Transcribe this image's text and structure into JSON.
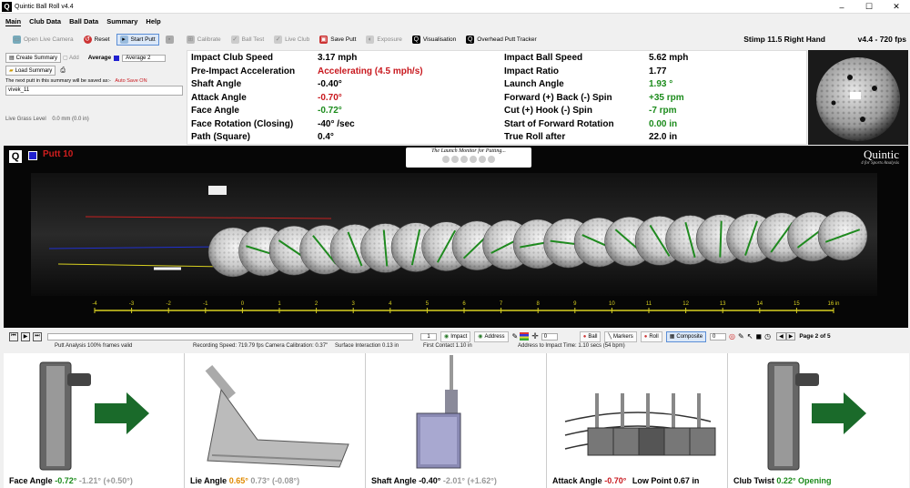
{
  "window": {
    "title": "Quintic Ball Roll v4.4"
  },
  "menu": [
    "Main",
    "Club Data",
    "Ball Data",
    "Summary",
    "Help"
  ],
  "toolbar": {
    "open_live_camera": "Open Live Camera",
    "reset": "Reset",
    "start_putt": "Start Putt",
    "calibrate": "Calibrate",
    "ball_test": "Ball Test",
    "live_club": "Live Club",
    "save_putt": "Save Putt",
    "exposure": "Exposure",
    "visualisation": "Visualisation",
    "overhead": "Overhead Putt Tracker",
    "stimp": "Stimp 11.5  Right Hand",
    "version": "v4.4 - 720 fps"
  },
  "left": {
    "create_summary": "Create Summary",
    "add": "Add",
    "average_label": "Average",
    "average_value": "Average 2",
    "load_summary": "Load Summary",
    "next_putt_text": "The next putt in this summary will be saved as:-",
    "auto_save": "Auto Save ON",
    "filename": "vivek_11",
    "grass_label": "Live Grass Level",
    "grass_value": "0.0 mm   (0.0 in)"
  },
  "stats_left": [
    {
      "label": "Impact Club Speed",
      "value": "3.17 mph",
      "color": "#000000"
    },
    {
      "label": "Pre-Impact Acceleration",
      "value": "Accelerating (4.5 mph/s)",
      "color": "#c8171d"
    },
    {
      "label": "Shaft Angle",
      "value": "-0.40°",
      "color": "#000000"
    },
    {
      "label": "Attack Angle",
      "value": "-0.70°",
      "color": "#c8171d"
    },
    {
      "label": "Face Angle",
      "value": "-0.72°",
      "color": "#1b8b1b"
    },
    {
      "label": "Face Rotation (Closing)",
      "value": "-40° /sec",
      "color": "#000000"
    },
    {
      "label": "Path (Square)",
      "value": "0.4°",
      "color": "#000000"
    }
  ],
  "stats_right": [
    {
      "label": "Impact Ball Speed",
      "value": "5.62 mph",
      "color": "#000000"
    },
    {
      "label": "Impact Ratio",
      "value": "1.77",
      "color": "#000000"
    },
    {
      "label": "Launch Angle",
      "value": "1.93 °",
      "color": "#1b8b1b"
    },
    {
      "label": "Forward (+) Back (-) Spin",
      "value": "+35 rpm",
      "color": "#1b8b1b"
    },
    {
      "label": "Cut (+) Hook (-) Spin",
      "value": "-7 rpm",
      "color": "#1b8b1b"
    },
    {
      "label": "Start of Forward Rotation",
      "value": "0.00 in",
      "color": "#1b8b1b"
    },
    {
      "label": "True Roll after",
      "value": "22.0 in",
      "color": "#000000"
    }
  ],
  "video": {
    "putt_label": "Putt 10",
    "tagline": "The Launch Monitor for Putting...",
    "brand": "Quintic",
    "brand_sub": "4 for Sports Analysis",
    "scale_ticks": [
      "-4",
      "-3",
      "-2",
      "-1",
      "0",
      "1",
      "2",
      "3",
      "4",
      "5",
      "6",
      "7",
      "8",
      "9",
      "10",
      "11",
      "12",
      "13",
      "14",
      "15",
      "16 in"
    ]
  },
  "controls": {
    "frame": "1",
    "impact": "Impact",
    "address": "Address",
    "spin_value": "0",
    "ball": "Ball",
    "markers": "Markers",
    "roll": "Roll",
    "composite": "Composite",
    "spin2": "0",
    "page": "Page 2 of 5"
  },
  "status": {
    "analysis": "Putt Analysis 100% frames valid",
    "recording": "Recording Speed: 719.79 fps   Camera Calibration: 0.37\"",
    "surface": "Surface Interaction 0.13 in",
    "first_contact": "First Contact 1.10 in",
    "address_time": "Address to Impact Time: 1.10 secs (54 bpm)"
  },
  "panels": {
    "face": {
      "label": "Face Angle",
      "v1": "-0.72°",
      "v2": "-1.21°",
      "v3": "(+0.50°)"
    },
    "lie": {
      "label": "Lie Angle",
      "v1": "0.65°",
      "v2": "0.73°",
      "v3": "(-0.08°)"
    },
    "shaft": {
      "label": "Shaft Angle",
      "v1": "-0.40°",
      "v2": "-2.01°",
      "v3": "(+1.62°)"
    },
    "attack": {
      "label": "Attack Angle",
      "v1": "-0.70°",
      "low_label": "Low Point",
      "low_value": "0.67 in"
    },
    "twist": {
      "label": "Club Twist",
      "v1": "0.22°",
      "v2": "Opening"
    }
  }
}
